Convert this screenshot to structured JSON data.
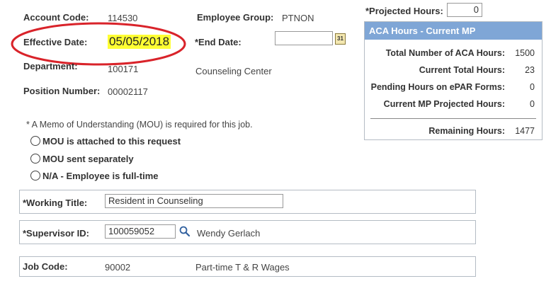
{
  "top": {
    "account_code_label": "Account Code:",
    "account_code_value": "114530",
    "employee_group_label": "Employee Group:",
    "employee_group_value": "PTNON",
    "effective_date_label": "Effective Date:",
    "effective_date_value": "05/05/2018",
    "end_date_label": "*End Date:",
    "end_date_value": "",
    "calendar_glyph": "31",
    "department_label": "Department:",
    "department_value": "100171",
    "department_name": "Counseling Center",
    "position_number_label": "Position Number:",
    "position_number_value": "00002117"
  },
  "projected": {
    "label": "*Projected Hours:",
    "value": "0"
  },
  "aca": {
    "title": "ACA Hours - Current MP",
    "rows": [
      {
        "label": "Total Number of ACA Hours:",
        "value": "1500"
      },
      {
        "label": "Current Total Hours:",
        "value": "23"
      },
      {
        "label": "Pending Hours on ePAR Forms:",
        "value": "0"
      },
      {
        "label": "Current MP Projected Hours:",
        "value": "0"
      }
    ],
    "remaining_label": "Remaining Hours:",
    "remaining_value": "1477",
    "header_color": "#7fa6d6"
  },
  "mou": {
    "note": "* A Memo of Understanding (MOU) is required for this job.",
    "options": [
      "MOU is attached to this request",
      "MOU sent separately",
      "N/A - Employee is full-time"
    ]
  },
  "working_title": {
    "label": "*Working Title:",
    "value": "Resident in Counseling"
  },
  "supervisor": {
    "label": "*Supervisor ID:",
    "value": "100059052",
    "name": "Wendy Gerlach"
  },
  "job": {
    "label": "Job Code:",
    "code": "90002",
    "description": "Part-time T & R Wages"
  },
  "colors": {
    "highlight": "#ffff33",
    "ellipse": "#d9232a"
  }
}
